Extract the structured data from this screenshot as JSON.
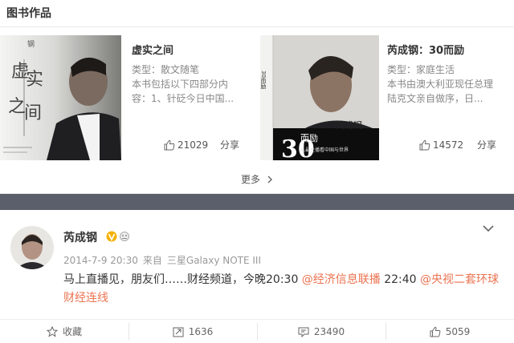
{
  "section": {
    "title": "图书作品"
  },
  "books": [
    {
      "title": "虚实之间",
      "type": "类型：散文随笔",
      "description": "本书包括以下四部分内容：1、针砭今日中国...",
      "likes": "21029",
      "share_label": "分享",
      "cover": {
        "big_text_1": "虚",
        "big_text_2": "实",
        "big_text_3": "之",
        "big_text_4": "间",
        "small_text": "钢"
      }
    },
    {
      "title": "芮成钢：30而励",
      "type": "类型：家庭生活",
      "description": "本书由澳大利亚现任总理陆克文亲自做序，日...",
      "likes": "14572",
      "share_label": "分享",
      "cover": {
        "num": "30",
        "title": "而励",
        "author": "芮成钢",
        "spine": "30而励",
        "tagline": "从最主播看中国与世界"
      }
    }
  ],
  "more": {
    "label": "更多"
  },
  "post": {
    "author": "芮成钢",
    "date": "2014-7-9 20:30",
    "source_prefix": "来自",
    "source": "三星Galaxy NOTE III",
    "text_1": "马上直播见，朋友们……财经频道，今晚20:30 ",
    "mention_1": "@经济信息联播",
    "text_2": " 22:40 ",
    "mention_2": "@央视二套环球财经连线",
    "actions": {
      "favorite": "收藏",
      "reposts": "1636",
      "comments": "23490",
      "likes": "5059"
    }
  },
  "colors": {
    "accent": "#eb7350",
    "verified": "#f5b100",
    "band": "#5b5f6c"
  }
}
